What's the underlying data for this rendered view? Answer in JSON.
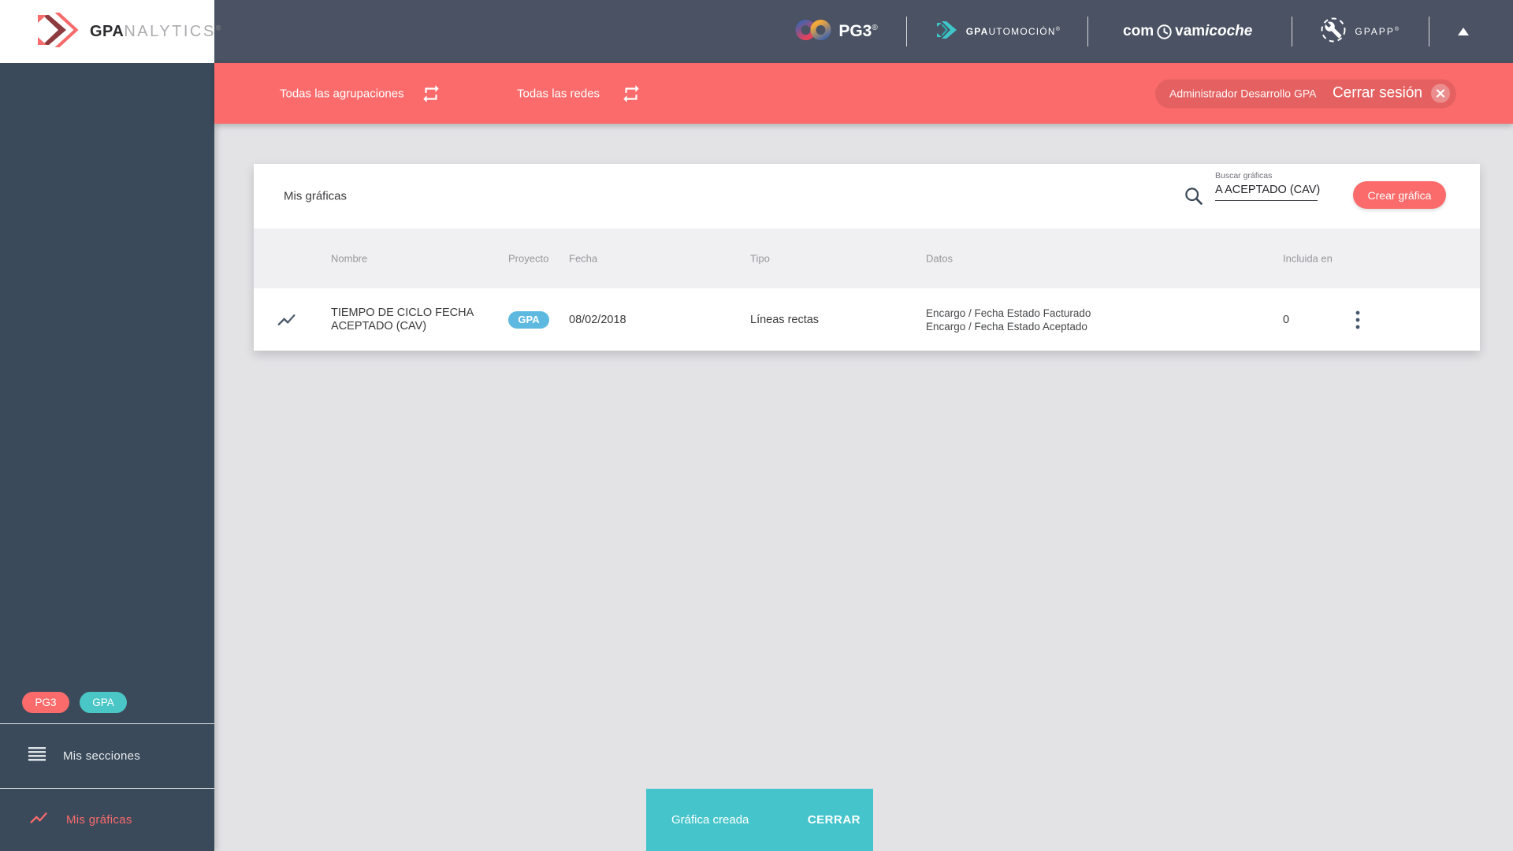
{
  "colors": {
    "accent_red": "#FB6B6B",
    "header_slate": "#4A5263",
    "sidebar_slate": "#3A4A5B",
    "toast_teal": "#45C5CB",
    "badge_teal": "#4BC6C6",
    "badge_blue": "#5EB9E0",
    "page_bg": "#E3E3E6",
    "table_header_bg": "#F0F0F2"
  },
  "brand": {
    "name_bold": "GPA",
    "name_light": "NALYTICS",
    "registered": "®"
  },
  "app_bar": {
    "pg3": "PG3",
    "automocion_bold": "GPA",
    "automocion_rest": "UTOMOCIÓN",
    "vamicoche_com": "com",
    "vamicoche_vam": "vam",
    "vamicoche_rest": "icoche",
    "gpapp": "GPAPP"
  },
  "filter_bar": {
    "groupings": "Todas las agrupaciones",
    "networks": "Todas las redes",
    "user": "Administrador Desarrollo GPA",
    "logout": "Cerrar sesión"
  },
  "sidebar": {
    "badges": [
      {
        "label": "PG3"
      },
      {
        "label": "GPA"
      }
    ],
    "items": [
      {
        "label": "Mis secciones"
      },
      {
        "label": "Mis gráficas"
      }
    ]
  },
  "card": {
    "title": "Mis gráficas",
    "search_label": "Buscar gráficas",
    "search_value": "A ACEPTADO (CAV)",
    "create_button": "Crear gráfica",
    "table": {
      "headers": [
        "Nombre",
        "Proyecto",
        "Fecha",
        "Tipo",
        "Datos",
        "Incluida en"
      ],
      "rows": [
        {
          "name_line1": "TIEMPO DE CICLO FECHA",
          "name_line2": "ACEPTADO (CAV)",
          "project": "GPA",
          "date": "08/02/2018",
          "type": "Líneas rectas",
          "data_line1": "Encargo / Fecha Estado Facturado",
          "data_line2": "Encargo / Fecha Estado Aceptado",
          "included_in": "0"
        }
      ]
    }
  },
  "toast": {
    "message": "Gráfica creada",
    "action": "CERRAR"
  }
}
